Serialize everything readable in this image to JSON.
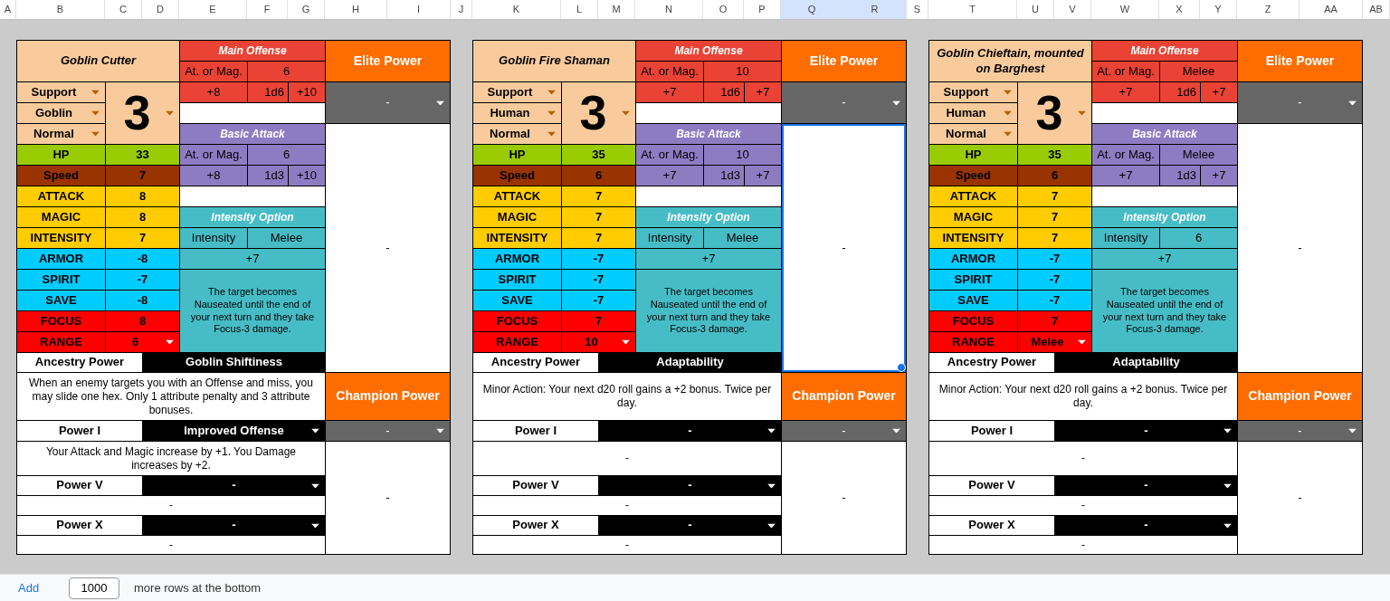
{
  "columns": [
    {
      "label": "A",
      "selected": false
    },
    {
      "label": "B",
      "selected": false
    },
    {
      "label": "C",
      "selected": false
    },
    {
      "label": "D",
      "selected": false
    },
    {
      "label": "E",
      "selected": false
    },
    {
      "label": "F",
      "selected": false
    },
    {
      "label": "G",
      "selected": false
    },
    {
      "label": "H",
      "selected": false
    },
    {
      "label": "I",
      "selected": false
    },
    {
      "label": "J",
      "selected": false
    },
    {
      "label": "K",
      "selected": false
    },
    {
      "label": "L",
      "selected": false
    },
    {
      "label": "M",
      "selected": false
    },
    {
      "label": "N",
      "selected": false
    },
    {
      "label": "O",
      "selected": false
    },
    {
      "label": "P",
      "selected": false
    },
    {
      "label": "Q",
      "selected": true
    },
    {
      "label": "R",
      "selected": true
    },
    {
      "label": "S",
      "selected": false
    },
    {
      "label": "T",
      "selected": false
    },
    {
      "label": "U",
      "selected": false
    },
    {
      "label": "V",
      "selected": false
    },
    {
      "label": "W",
      "selected": false
    },
    {
      "label": "X",
      "selected": false
    },
    {
      "label": "Y",
      "selected": false
    },
    {
      "label": "Z",
      "selected": false
    },
    {
      "label": "AA",
      "selected": false
    },
    {
      "label": "AB",
      "selected": false
    }
  ],
  "cards": [
    {
      "name": "Goblin Cutter",
      "role": "Support",
      "ancestry": "Goblin",
      "rank": "Normal",
      "level": "3",
      "main_offense": {
        "title": "Main Offense",
        "stat_label": "At. or Mag.",
        "stat_value": "6",
        "hit": "+8",
        "dice": "1d6",
        "damage": "+10"
      },
      "basic_attack": {
        "title": "Basic Attack",
        "stat_label": "At. or Mag.",
        "stat_value": "6",
        "hit": "+8",
        "dice": "1d3",
        "damage": "+10"
      },
      "intensity": {
        "title": "Intensity Option",
        "label": "Intensity",
        "value": "Melee",
        "bonus": "+7",
        "effect": "The target becomes Nauseated until the end of your next turn and they take Focus-3 damage."
      },
      "stats": [
        {
          "label": "HP",
          "value": "33",
          "color": "#99cc00",
          "kind": "plain"
        },
        {
          "label": "Speed",
          "value": "7",
          "color": "#993300",
          "kind": "plain"
        },
        {
          "label": "ATTACK",
          "value": "8",
          "color": "#ffcc00",
          "kind": "plain"
        },
        {
          "label": "MAGIC",
          "value": "8",
          "color": "#ffcc00",
          "kind": "plain"
        },
        {
          "label": "INTENSITY",
          "value": "7",
          "color": "#ffcc00",
          "kind": "plain"
        },
        {
          "label": "ARMOR",
          "value": "-8",
          "color": "#00ccff",
          "kind": "plain"
        },
        {
          "label": "SPIRIT",
          "value": "-7",
          "color": "#00ccff",
          "kind": "plain"
        },
        {
          "label": "SAVE",
          "value": "-8",
          "color": "#00ccff",
          "kind": "plain"
        },
        {
          "label": "FOCUS",
          "value": "8",
          "color": "#ff0000",
          "kind": "plain"
        },
        {
          "label": "RANGE",
          "value": "6",
          "color": "#ff0000",
          "kind": "select"
        }
      ],
      "elite": {
        "title": "Elite Power",
        "choice": "-",
        "text": "-",
        "selected": false
      },
      "ancestry_power": {
        "label": "Ancestry Power",
        "name": "Goblin Shiftiness",
        "text": "When an enemy targets you with an Offense and miss, you may slide one hex. Only 1 attribute penalty and 3 attribute bonuses."
      },
      "champion": {
        "title": "Champion Power",
        "choice": "-",
        "text": "-"
      },
      "powers": [
        {
          "label": "Power I",
          "name": "Improved Offense",
          "text": "Your Attack and Magic increase by +1. You Damage increases by +2."
        },
        {
          "label": "Power V",
          "name": "-",
          "text": "-"
        },
        {
          "label": "Power X",
          "name": "-",
          "text": "-"
        }
      ]
    },
    {
      "name": "Goblin Fire Shaman",
      "role": "Support",
      "ancestry": "Human",
      "rank": "Normal",
      "level": "3",
      "main_offense": {
        "title": "Main Offense",
        "stat_label": "At. or Mag.",
        "stat_value": "10",
        "hit": "+7",
        "dice": "1d6",
        "damage": "+7"
      },
      "basic_attack": {
        "title": "Basic Attack",
        "stat_label": "At. or Mag.",
        "stat_value": "10",
        "hit": "+7",
        "dice": "1d3",
        "damage": "+7"
      },
      "intensity": {
        "title": "Intensity Option",
        "label": "Intensity",
        "value": "Melee",
        "bonus": "+7",
        "effect": "The target becomes Nauseated until the end of your next turn and they take Focus-3 damage."
      },
      "stats": [
        {
          "label": "HP",
          "value": "35",
          "color": "#99cc00",
          "kind": "plain"
        },
        {
          "label": "Speed",
          "value": "6",
          "color": "#993300",
          "kind": "plain"
        },
        {
          "label": "ATTACK",
          "value": "7",
          "color": "#ffcc00",
          "kind": "plain"
        },
        {
          "label": "MAGIC",
          "value": "7",
          "color": "#ffcc00",
          "kind": "plain"
        },
        {
          "label": "INTENSITY",
          "value": "7",
          "color": "#ffcc00",
          "kind": "plain"
        },
        {
          "label": "ARMOR",
          "value": "-7",
          "color": "#00ccff",
          "kind": "plain"
        },
        {
          "label": "SPIRIT",
          "value": "-7",
          "color": "#00ccff",
          "kind": "plain"
        },
        {
          "label": "SAVE",
          "value": "-7",
          "color": "#00ccff",
          "kind": "plain"
        },
        {
          "label": "FOCUS",
          "value": "7",
          "color": "#ff0000",
          "kind": "plain"
        },
        {
          "label": "RANGE",
          "value": "10",
          "color": "#ff0000",
          "kind": "select"
        }
      ],
      "elite": {
        "title": "Elite Power",
        "choice": "-",
        "text": "-",
        "selected": true
      },
      "ancestry_power": {
        "label": "Ancestry Power",
        "name": "Adaptability",
        "text": "Minor Action: Your next d20 roll gains a +2 bonus. Twice per day."
      },
      "champion": {
        "title": "Champion Power",
        "choice": "-",
        "text": "-"
      },
      "powers": [
        {
          "label": "Power I",
          "name": "-",
          "text": "-"
        },
        {
          "label": "Power V",
          "name": "-",
          "text": "-"
        },
        {
          "label": "Power X",
          "name": "-",
          "text": "-"
        }
      ]
    },
    {
      "name": "Goblin Chieftain, mounted on Barghest",
      "role": "Support",
      "ancestry": "Human",
      "rank": "Normal",
      "level": "3",
      "main_offense": {
        "title": "Main Offense",
        "stat_label": "At. or Mag.",
        "stat_value": "Melee",
        "hit": "+7",
        "dice": "1d6",
        "damage": "+7"
      },
      "basic_attack": {
        "title": "Basic Attack",
        "stat_label": "At. or Mag.",
        "stat_value": "Melee",
        "hit": "+7",
        "dice": "1d3",
        "damage": "+7"
      },
      "intensity": {
        "title": "Intensity Option",
        "label": "Intensity",
        "value": "6",
        "bonus": "+7",
        "effect": "The target becomes Nauseated until the end of your next turn and they take Focus-3 damage."
      },
      "stats": [
        {
          "label": "HP",
          "value": "35",
          "color": "#99cc00",
          "kind": "plain"
        },
        {
          "label": "Speed",
          "value": "6",
          "color": "#993300",
          "kind": "plain"
        },
        {
          "label": "ATTACK",
          "value": "7",
          "color": "#ffcc00",
          "kind": "plain"
        },
        {
          "label": "MAGIC",
          "value": "7",
          "color": "#ffcc00",
          "kind": "plain"
        },
        {
          "label": "INTENSITY",
          "value": "7",
          "color": "#ffcc00",
          "kind": "plain"
        },
        {
          "label": "ARMOR",
          "value": "-7",
          "color": "#00ccff",
          "kind": "plain"
        },
        {
          "label": "SPIRIT",
          "value": "-7",
          "color": "#00ccff",
          "kind": "plain"
        },
        {
          "label": "SAVE",
          "value": "-7",
          "color": "#00ccff",
          "kind": "plain"
        },
        {
          "label": "FOCUS",
          "value": "7",
          "color": "#ff0000",
          "kind": "plain"
        },
        {
          "label": "RANGE",
          "value": "Melee",
          "color": "#ff0000",
          "kind": "select"
        }
      ],
      "elite": {
        "title": "Elite Power",
        "choice": "-",
        "text": "-",
        "selected": false
      },
      "ancestry_power": {
        "label": "Ancestry Power",
        "name": "Adaptability",
        "text": "Minor Action: Your next d20 roll gains a +2 bonus. Twice per day."
      },
      "champion": {
        "title": "Champion Power",
        "choice": "-",
        "text": "-"
      },
      "powers": [
        {
          "label": "Power I",
          "name": "-",
          "text": "-"
        },
        {
          "label": "Power V",
          "name": "-",
          "text": "-"
        },
        {
          "label": "Power X",
          "name": "-",
          "text": "-"
        }
      ]
    }
  ],
  "footer": {
    "link": "Add",
    "rows_value": "1000",
    "suffix": "more rows at the bottom"
  }
}
